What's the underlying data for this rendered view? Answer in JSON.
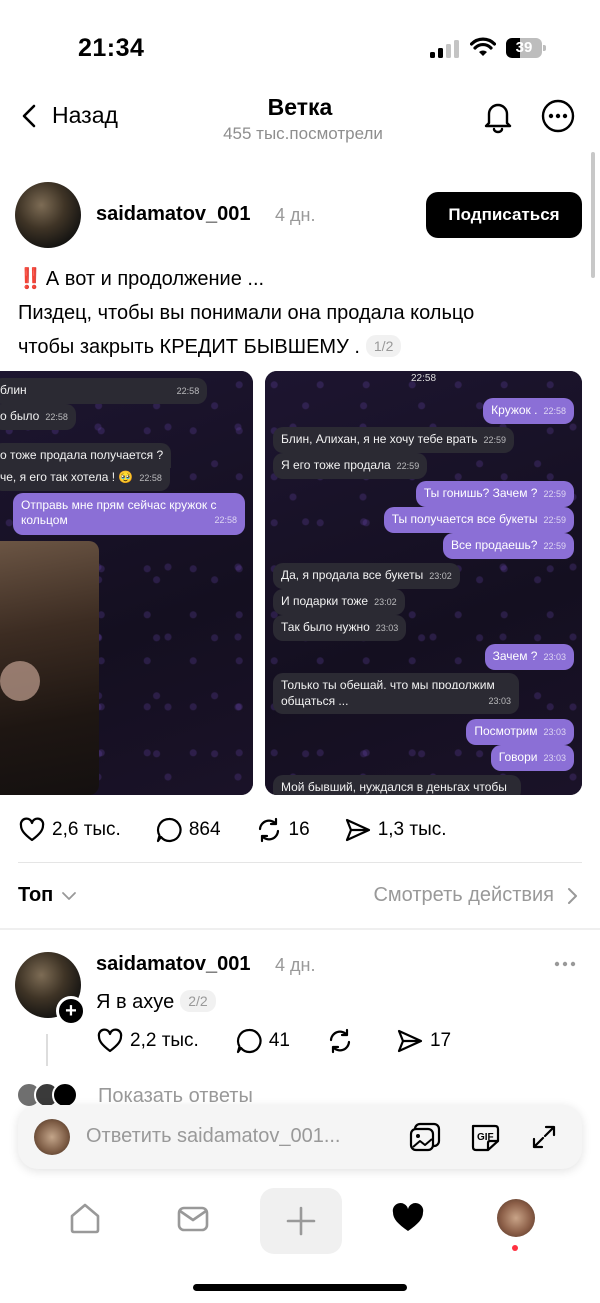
{
  "status_bar": {
    "time": "21:34",
    "battery": "39",
    "battery_level": 0.39
  },
  "header": {
    "back_label": "Назад",
    "title": "Ветка",
    "subtitle": "455 тыс.посмотрели"
  },
  "post": {
    "username": "saidamatov_001",
    "time": "4 дн.",
    "follow_label": "Подписаться",
    "exclamation": "‼️",
    "line1": "А вот и продолжение ...",
    "line2": "Пиздец, чтобы вы понимали она продала кольцо",
    "line3": "чтобы закрыть КРЕДИТ БЫВШЕМУ .",
    "page_indicator": "1/2",
    "likes": "2,6 тыс.",
    "comments": "864",
    "reposts": "16",
    "shares": "1,3 тыс."
  },
  "media_left": {
    "messages": [
      {
        "text": "блин",
        "time": "22:58",
        "dir": "in"
      },
      {
        "text": "о было",
        "time": "22:58",
        "dir": "in"
      },
      {
        "text": "о тоже продала получается ?",
        "time": "",
        "dir": "in"
      },
      {
        "text": "че, я его так хотела ! 🥹",
        "time": "22:58",
        "dir": "in"
      },
      {
        "text": "Отправь мне прям сейчас кружок с",
        "time": "",
        "dir": "out"
      },
      {
        "text": "кольцом",
        "time": "22:58",
        "dir": "out"
      }
    ]
  },
  "media_right": {
    "header_time": "22:58",
    "messages": [
      {
        "text": "Кружок .",
        "time": "22:58",
        "dir": "out"
      },
      {
        "text": "Блин, Алихан, я не хочу тебе врать",
        "time": "22:59",
        "dir": "in"
      },
      {
        "text": "Я его тоже продала",
        "time": "22:59",
        "dir": "in"
      },
      {
        "text": "Ты гонишь? Зачем ?",
        "time": "22:59",
        "dir": "out"
      },
      {
        "text": "Ты получается все букеты",
        "time": "22:59",
        "dir": "out"
      },
      {
        "text": "Все продаешь?",
        "time": "22:59",
        "dir": "out"
      },
      {
        "text": "Да, я продала все букеты",
        "time": "23:02",
        "dir": "in"
      },
      {
        "text": "И подарки тоже",
        "time": "23:02",
        "dir": "in"
      },
      {
        "text": "Так было нужно",
        "time": "23:03",
        "dir": "in"
      },
      {
        "text": "Зачем ?",
        "time": "23:03",
        "dir": "out"
      },
      {
        "text": "Только ты обещай, что мы продолжим",
        "time": "",
        "dir": "in"
      },
      {
        "text": "общаться ...",
        "time": "23:03",
        "dir": "in"
      },
      {
        "text": "Посмотрим",
        "time": "23:03",
        "dir": "out"
      },
      {
        "text": "Говори",
        "time": "23:03",
        "dir": "out"
      },
      {
        "text": "Мой бывший, нуждался в деньгах чтобы",
        "time": "",
        "dir": "in"
      }
    ]
  },
  "sort": {
    "label": "Топ",
    "view_activity": "Смотреть действия"
  },
  "reply": {
    "username": "saidamatov_001",
    "time": "4 дн.",
    "text": "Я в ахуе",
    "page_indicator": "2/2",
    "likes": "2,2 тыс.",
    "comments": "41",
    "shares": "17",
    "show_replies": "Показать ответы"
  },
  "composer": {
    "placeholder": "Ответить saidamatov_001..."
  },
  "tabbar": {
    "items": [
      "home-icon",
      "inbox-icon",
      "create-icon",
      "activity-heart-icon",
      "profile-avatar"
    ]
  }
}
